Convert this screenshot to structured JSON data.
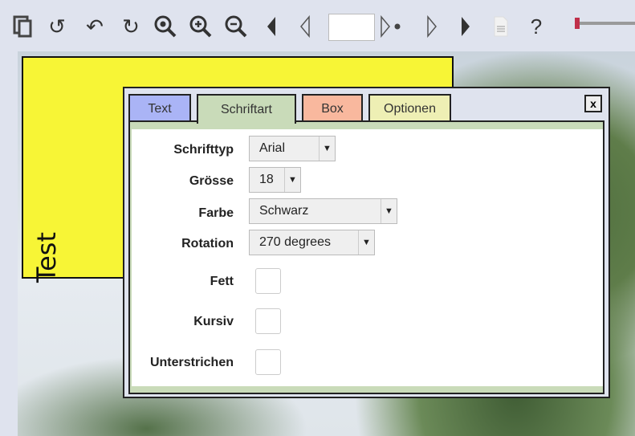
{
  "toolbar": {
    "icons": [
      "copy-icon",
      "undo-icon",
      "redo-icon",
      "refresh-icon",
      "zoom-fit-icon",
      "zoom-in-icon",
      "zoom-out-icon",
      "first-page-icon",
      "prev-page-icon",
      "next-page-dot-icon",
      "next-page-icon",
      "last-page-icon",
      "document-icon",
      "help-icon"
    ],
    "page_value": ""
  },
  "canvas": {
    "box_text": "Test",
    "box_color": "#f7f536"
  },
  "dialog": {
    "tabs": [
      {
        "label": "Text",
        "color": "#aab4f6"
      },
      {
        "label": "Schriftart",
        "color": "#c9dbb9"
      },
      {
        "label": "Box",
        "color": "#f9b89e"
      },
      {
        "label": "Optionen",
        "color": "#eeefb4"
      }
    ],
    "close_label": "x",
    "fields": {
      "font_label": "Schrifttyp",
      "font_value": "Arial",
      "size_label": "Grösse",
      "size_value": "18",
      "color_label": "Farbe",
      "color_value": "Schwarz",
      "rotation_label": "Rotation",
      "rotation_value": "270 degrees",
      "bold_label": "Fett",
      "italic_label": "Kursiv",
      "underline_label": "Unterstrichen"
    }
  }
}
